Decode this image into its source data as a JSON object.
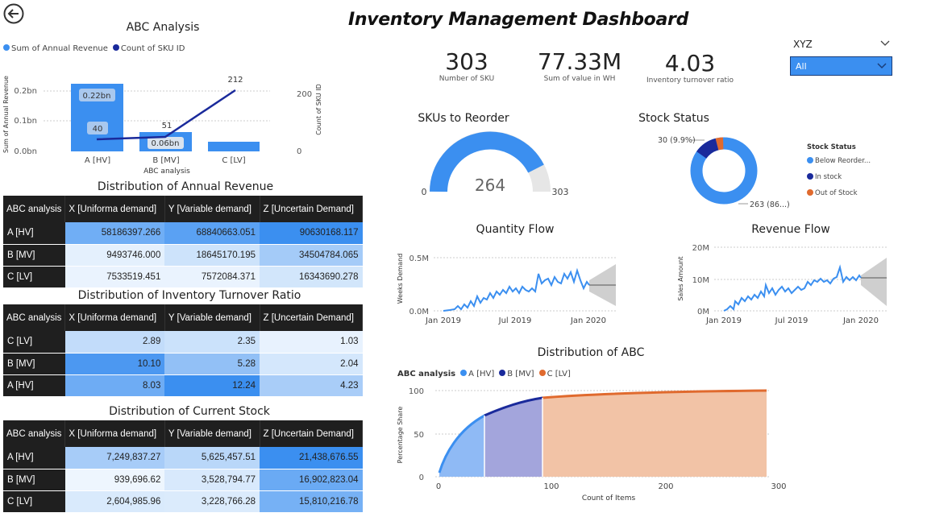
{
  "header": {
    "title": "Inventory Management Dashboard"
  },
  "slicer": {
    "label": "XYZ",
    "value": "All"
  },
  "kpis": [
    {
      "value": "303",
      "label": "Number of SKU"
    },
    {
      "value": "77.33M",
      "label": "Sum of value in WH"
    },
    {
      "value": "4.03",
      "label": "Inventory turnover ratio"
    }
  ],
  "abc_chart": {
    "title": "ABC Analysis",
    "legend": [
      "Sum of Annual Revenue",
      "Count of SKU ID"
    ],
    "ylabel": "Sum of Annual Revenue",
    "y2label": "Count of SKU ID",
    "xlabel": "ABC analysis",
    "yticks": [
      "0.2bn",
      "0.1bn",
      "0.0bn"
    ],
    "y2ticks": [
      "200",
      "0"
    ],
    "bar_labels": [
      "0.22bn",
      "0.06bn"
    ],
    "line_labels": [
      "40",
      "51",
      "212"
    ],
    "colors": {
      "bar": "#3b8ff0",
      "line": "#1a2a9b"
    }
  },
  "tables": {
    "revenue": {
      "title": "Distribution of Annual Revenue",
      "headers": [
        "ABC analysis",
        "X [Uniforma demand]",
        "Y [Variable demand]",
        "Z [Uncertain Demand]"
      ],
      "rows": [
        {
          "label": "A [HV]",
          "cells": [
            "58186397.266",
            "68840663.051",
            "90630168.117"
          ]
        },
        {
          "label": "B [MV]",
          "cells": [
            "9493746.000",
            "18645170.195",
            "34504784.065"
          ]
        },
        {
          "label": "C [LV]",
          "cells": [
            "7533519.451",
            "7572084.371",
            "16343690.278"
          ]
        }
      ]
    },
    "turnover": {
      "title": "Distribution of Inventory Turnover Ratio",
      "headers": [
        "ABC analysis",
        "X [Uniforma demand]",
        "Y [Variable demand]",
        "Z [Uncertain Demand]"
      ],
      "rows": [
        {
          "label": "C [LV]",
          "cells": [
            "2.89",
            "2.35",
            "1.03"
          ]
        },
        {
          "label": "B [MV]",
          "cells": [
            "10.10",
            "5.28",
            "2.04"
          ]
        },
        {
          "label": "A [HV]",
          "cells": [
            "8.03",
            "12.24",
            "4.23"
          ]
        }
      ]
    },
    "stock": {
      "title": "Distribution of Current Stock",
      "headers": [
        "ABC analysis",
        "X [Uniforma demand]",
        "Y [Variable demand]",
        "Z [Uncertain Demand]"
      ],
      "rows": [
        {
          "label": "A [HV]",
          "cells": [
            "7,249,837.27",
            "5,625,457.51",
            "21,438,676.55"
          ]
        },
        {
          "label": "B [MV]",
          "cells": [
            "939,696.62",
            "3,528,794.77",
            "16,902,823.04"
          ]
        },
        {
          "label": "C [LV]",
          "cells": [
            "2,604,985.96",
            "3,228,766.28",
            "15,810,216.78"
          ]
        }
      ]
    }
  },
  "reorder": {
    "title": "SKUs to Reorder",
    "value": "264",
    "min": "0",
    "max": "303"
  },
  "stock_status": {
    "title": "Stock Status",
    "legend_title": "Stock Status",
    "legend": [
      "Below Reorder...",
      "In stock",
      "Out of Stock"
    ],
    "labels": [
      "30 (9.9%)",
      "263 (86...)"
    ],
    "colors": [
      "#3b8ff0",
      "#1a2a9b",
      "#e06a2e"
    ]
  },
  "qty_flow": {
    "title": "Quantity Flow",
    "ylabel": "Weeks Demand",
    "yticks": [
      "0.5M",
      "0.0M"
    ],
    "xticks": [
      "Jan 2019",
      "Jul 2019",
      "Jan 2020"
    ]
  },
  "rev_flow": {
    "title": "Revenue Flow",
    "ylabel": "Sales Amount",
    "yticks": [
      "20M",
      "10M",
      "0M"
    ],
    "xticks": [
      "Jan 2019",
      "Jul 2019",
      "Jan 2020"
    ]
  },
  "dist_abc": {
    "title": "Distribution of ABC",
    "legend_title": "ABC analysis",
    "legend": [
      "A [HV]",
      "B [MV]",
      "C [LV]"
    ],
    "ylabel": "Percentage Share",
    "xlabel": "Count of Items",
    "yticks": [
      "100",
      "50",
      "0"
    ],
    "xticks": [
      "0",
      "100",
      "200",
      "300"
    ],
    "colors": [
      "#3b8ff0",
      "#1a2a9b",
      "#e06a2e"
    ]
  }
}
